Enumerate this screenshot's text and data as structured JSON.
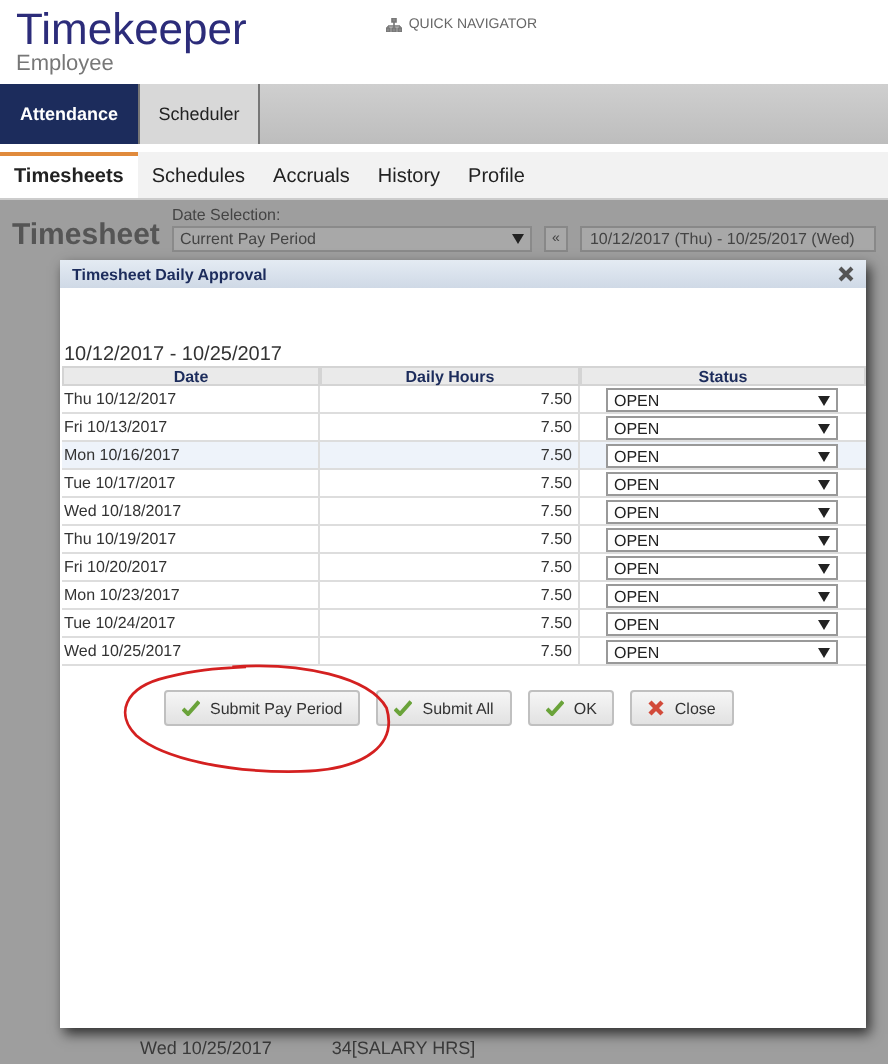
{
  "header": {
    "title": "Timekeeper",
    "subtitle": "Employee",
    "quick_nav": "QUICK NAVIGATOR"
  },
  "tabs": [
    {
      "label": "Attendance",
      "selected": true
    },
    {
      "label": "Scheduler",
      "selected": false
    }
  ],
  "subtabs": [
    {
      "label": "Timesheets",
      "selected": true
    },
    {
      "label": "Schedules",
      "selected": false
    },
    {
      "label": "Accruals",
      "selected": false
    },
    {
      "label": "History",
      "selected": false
    },
    {
      "label": "Profile",
      "selected": false
    }
  ],
  "toolbar": {
    "title": "Timesheet",
    "date_label": "Date Selection:",
    "period": "Current Pay Period",
    "prev_button": "«",
    "range": "10/12/2017 (Thu) - 10/25/2017 (Wed)"
  },
  "background_row": [
    "Wed 10/25/2017",
    "34[SALARY HRS]"
  ],
  "dialog": {
    "title": "Timesheet Daily Approval",
    "range": "10/12/2017 - 10/25/2017",
    "columns": [
      "Date",
      "Daily Hours",
      "Status"
    ],
    "rows": [
      {
        "date": "Thu 10/12/2017",
        "hours": "7.50",
        "status": "OPEN",
        "highlighted": false
      },
      {
        "date": "Fri 10/13/2017",
        "hours": "7.50",
        "status": "OPEN",
        "highlighted": false
      },
      {
        "date": "Mon 10/16/2017",
        "hours": "7.50",
        "status": "OPEN",
        "highlighted": true
      },
      {
        "date": "Tue 10/17/2017",
        "hours": "7.50",
        "status": "OPEN",
        "highlighted": false
      },
      {
        "date": "Wed 10/18/2017",
        "hours": "7.50",
        "status": "OPEN",
        "highlighted": false
      },
      {
        "date": "Thu 10/19/2017",
        "hours": "7.50",
        "status": "OPEN",
        "highlighted": false
      },
      {
        "date": "Fri 10/20/2017",
        "hours": "7.50",
        "status": "OPEN",
        "highlighted": false
      },
      {
        "date": "Mon 10/23/2017",
        "hours": "7.50",
        "status": "OPEN",
        "highlighted": false
      },
      {
        "date": "Tue 10/24/2017",
        "hours": "7.50",
        "status": "OPEN",
        "highlighted": false
      },
      {
        "date": "Wed 10/25/2017",
        "hours": "7.50",
        "status": "OPEN",
        "highlighted": false
      }
    ],
    "buttons": [
      {
        "label": "Submit Pay Period",
        "kind": "check"
      },
      {
        "label": "Submit All",
        "kind": "check"
      },
      {
        "label": "OK",
        "kind": "check"
      },
      {
        "label": "Close",
        "kind": "cross"
      }
    ]
  }
}
